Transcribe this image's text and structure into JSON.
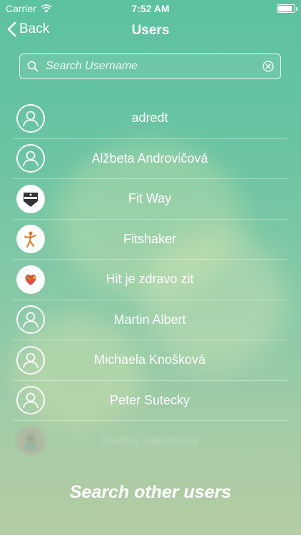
{
  "status": {
    "carrier": "Carrier",
    "time": "7:52 AM",
    "battery_level": 0.9
  },
  "nav": {
    "back_label": "Back",
    "title": "Users"
  },
  "search": {
    "placeholder": "Search Username",
    "value": ""
  },
  "users": [
    {
      "name": "adredt",
      "avatar": "person-placeholder-icon"
    },
    {
      "name": "Alžbeta Androvičová",
      "avatar": "person-placeholder-icon"
    },
    {
      "name": "Fit Way",
      "avatar": "fit-way-logo"
    },
    {
      "name": "Fitshaker",
      "avatar": "fitshaker-logo"
    },
    {
      "name": "Hit je zdravo zit",
      "avatar": "hit-je-zdravo-zit-logo"
    },
    {
      "name": "Martin Albert",
      "avatar": "person-placeholder-icon"
    },
    {
      "name": "Michaela Knošková",
      "avatar": "person-placeholder-icon"
    },
    {
      "name": "Peter Sutecky",
      "avatar": "person-placeholder-icon"
    },
    {
      "name": "Radka Jakobova",
      "avatar": "user-photo"
    }
  ],
  "footer": {
    "label": "Search other users"
  },
  "colors": {
    "background_top": "#5cc2a0",
    "background_bottom": "#b4cda4",
    "text": "#ffffff"
  }
}
